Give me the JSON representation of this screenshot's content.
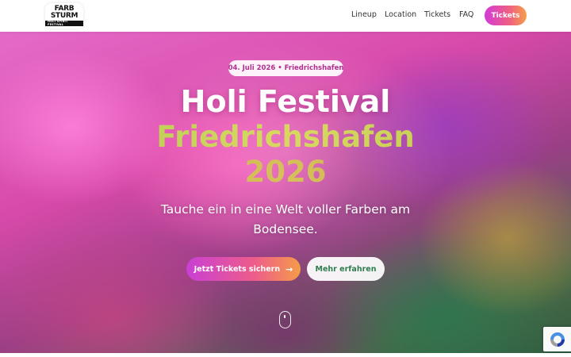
{
  "header": {
    "logo": {
      "line1": "FARB",
      "line2": "STURM",
      "line3": "HOLI SPIRIT FESTIVAL"
    },
    "nav": [
      {
        "label": "Lineup"
      },
      {
        "label": "Location"
      },
      {
        "label": "Tickets"
      },
      {
        "label": "FAQ"
      }
    ],
    "cta_label": "Tickets"
  },
  "hero": {
    "date_badge": "04. Juli 2026 • Friedrichshafen",
    "title_line1": "Holi Festival",
    "title_line2": "Friedrichshafen",
    "title_line3": "2026",
    "subtitle": "Tauche ein in eine Welt voller Farben am Bodensee.",
    "primary_button": "Jetzt Tickets sichern",
    "primary_button_icon": "arrow-right-icon",
    "secondary_button": "Mehr erfahren",
    "scroll_icon": "mouse-scroll-icon"
  },
  "colors": {
    "accent_gradient_start": "#c93fd4",
    "accent_gradient_mid": "#ee5d8a",
    "accent_gradient_end": "#f49c48",
    "date_text": "#b0308e",
    "secondary_button_text": "#2e7d4f",
    "title_line2": "#b9c94f",
    "title_line3": "#c8b046"
  },
  "recaptcha": {
    "icon": "recaptcha-icon"
  }
}
